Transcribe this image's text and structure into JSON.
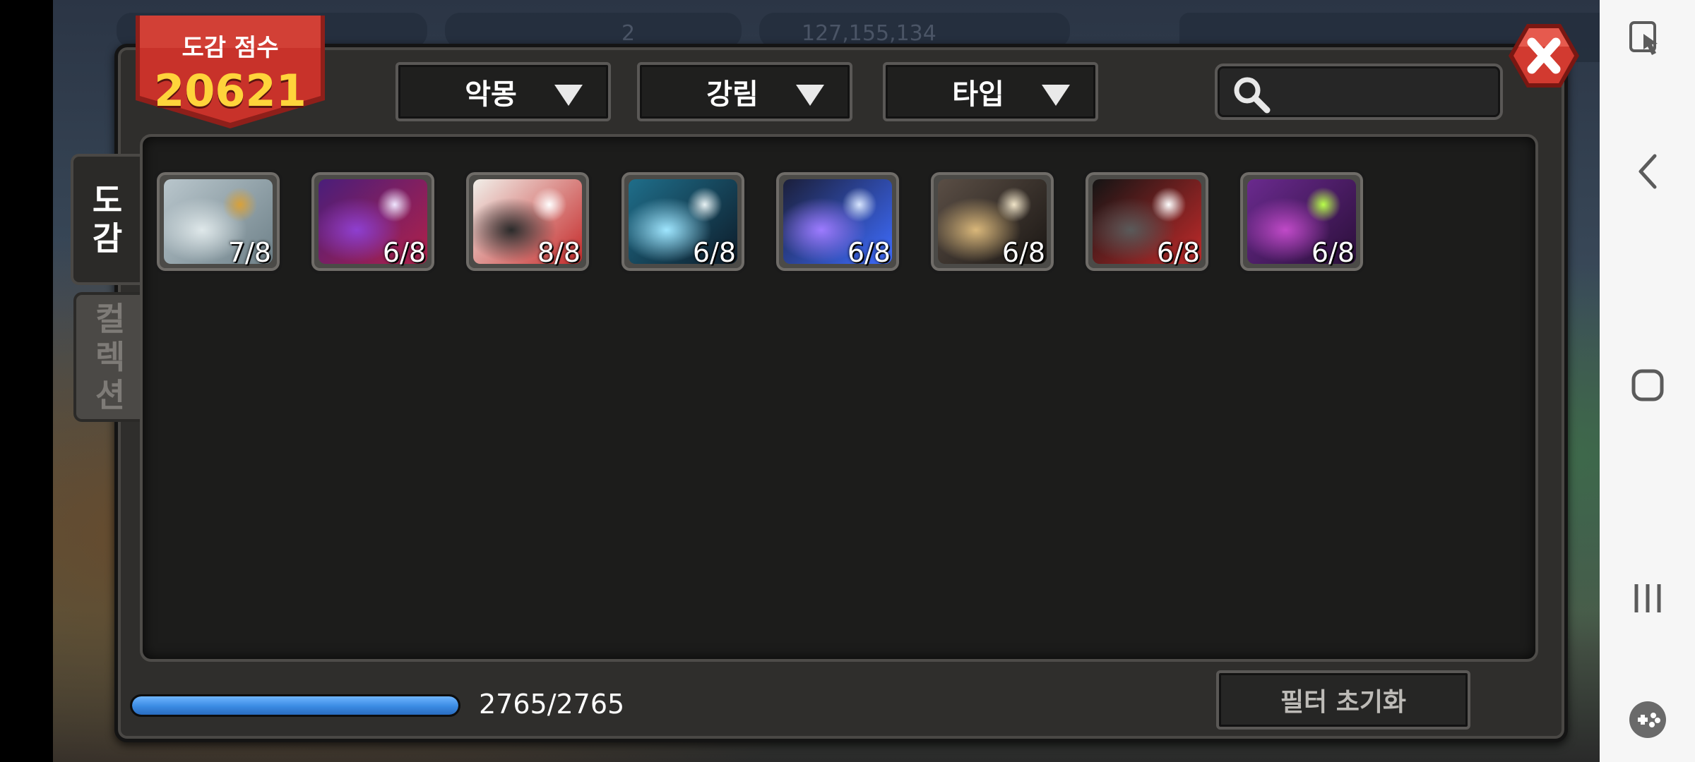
{
  "score": {
    "label": "도감 점수",
    "value": "20621"
  },
  "filters": [
    {
      "label": "악몽"
    },
    {
      "label": "강림"
    },
    {
      "label": "타입"
    }
  ],
  "search": {
    "placeholder": "",
    "value": ""
  },
  "tabs": [
    {
      "label": "도\n감"
    },
    {
      "label": "컬\n렉\n션"
    }
  ],
  "cards": [
    {
      "count": "7/8",
      "palette": [
        "#b9c6cc",
        "#6e8189",
        "#dfe8ea",
        "#d8a13a"
      ]
    },
    {
      "count": "6/8",
      "palette": [
        "#4a1e7a",
        "#b0204a",
        "#8e3fd0",
        "#f0e6ff"
      ]
    },
    {
      "count": "8/8",
      "palette": [
        "#f1efe9",
        "#c52a2a",
        "#2b2b2b",
        "#ffffff"
      ]
    },
    {
      "count": "6/8",
      "palette": [
        "#1f6e8a",
        "#0d1c2a",
        "#9fe6ff",
        "#e8f2f4"
      ]
    },
    {
      "count": "6/8",
      "palette": [
        "#1b1f3a",
        "#3e6cff",
        "#9d7bff",
        "#d8e6ff"
      ]
    },
    {
      "count": "6/8",
      "palette": [
        "#5a4e45",
        "#1b1714",
        "#d9b77a",
        "#f0e4c8"
      ]
    },
    {
      "count": "6/8",
      "palette": [
        "#141414",
        "#c22a2a",
        "#5a5a5a",
        "#ffffff"
      ]
    },
    {
      "count": "6/8",
      "palette": [
        "#6a2a8e",
        "#2b0f3a",
        "#c04ac8",
        "#b8ff4a"
      ]
    }
  ],
  "progress": {
    "current": 2765,
    "total": 2765,
    "text": "2765/2765"
  },
  "reset_button": {
    "label": "필터 초기화"
  },
  "background": {
    "ghost_1": "2",
    "ghost_2": "127,155,134"
  },
  "colors": {
    "accent_red": "#c8322a",
    "score_yellow": "#ffd43b",
    "progress_blue": "#4a9be8"
  }
}
